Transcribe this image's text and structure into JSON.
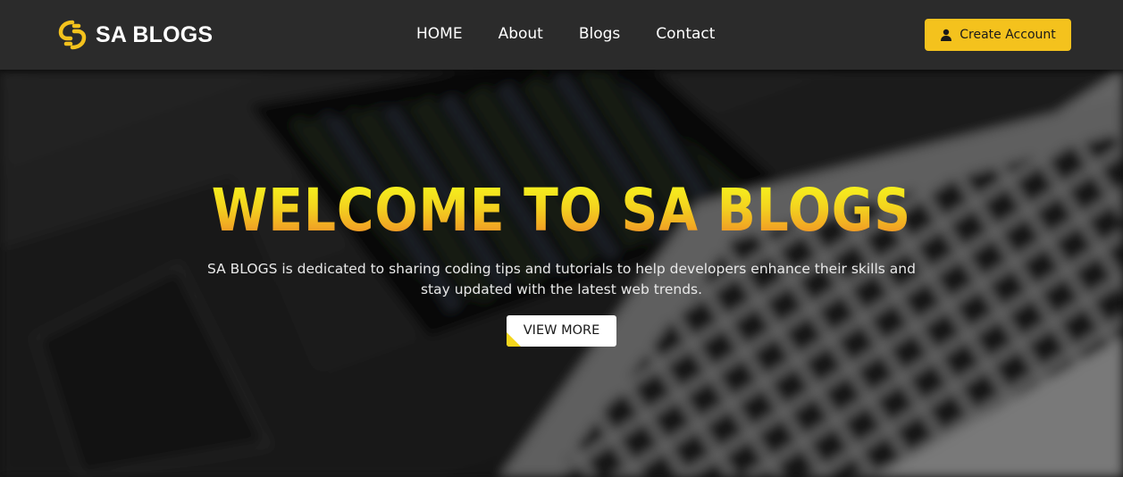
{
  "navbar": {
    "brand_name": "SA BLOGS",
    "brand_icon": "sa-blogs-logo-icon",
    "links": [
      {
        "label": "HOME"
      },
      {
        "label": "About"
      },
      {
        "label": "Blogs"
      },
      {
        "label": "Contact"
      }
    ],
    "create_account_label": "Create Account",
    "create_account_icon": "user-icon"
  },
  "hero": {
    "title": "WELCOME TO SA BLOGS",
    "description": "SA BLOGS is dedicated to sharing coding tips and tutorials to help developers enhance their skills and stay updated with the latest web trends.",
    "view_more_label": "VIEW MORE"
  },
  "colors": {
    "accent": "#f4c21d",
    "navbar_bg": "#2b2b2b",
    "title_gradient_top": "#f7ff1c",
    "title_gradient_bottom": "#ef7a28"
  }
}
